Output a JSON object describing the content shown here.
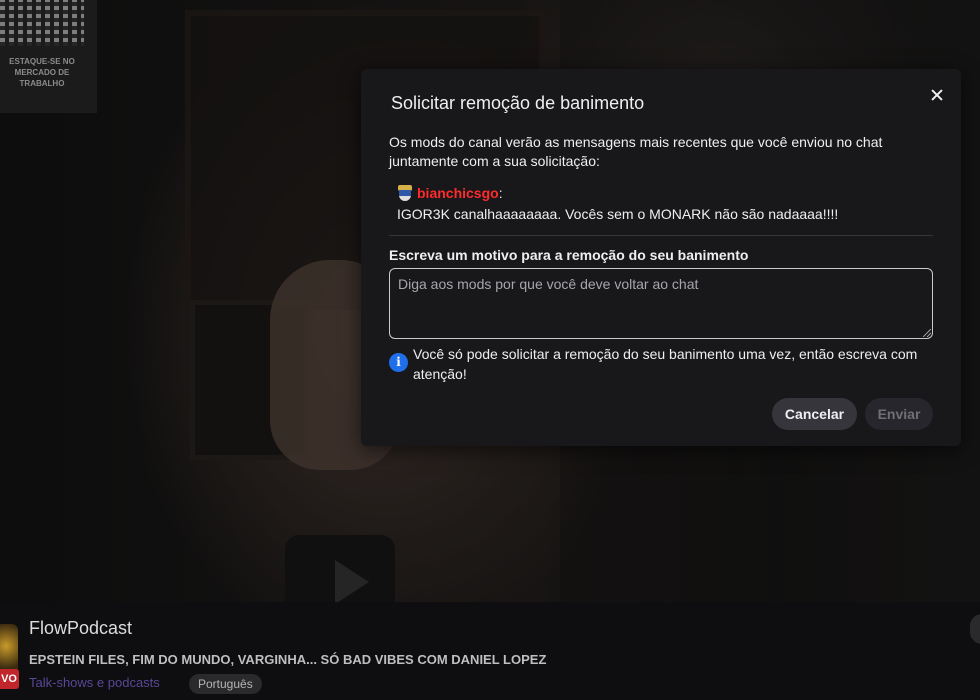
{
  "promo": {
    "text": "ESTAQUE-SE NO MERCADO DE TRABALHO"
  },
  "channel": {
    "name": "FlowPodcast",
    "stream_title": "EPSTEIN FILES, FIM DO MUNDO, VARGINHA... SÓ BAD VIBES COM DANIEL LOPEZ",
    "category": "Talk-shows e podcasts",
    "language": "Português",
    "live_label": "VO"
  },
  "modal": {
    "title": "Solicitar remoção de banimento",
    "description": "Os mods do canal verão as mensagens mais recentes que você enviou no chat juntamente com a sua solicitação:",
    "message": {
      "badge_icon": "2032-badge-icon",
      "username": "bianchicsgo",
      "colon": ":",
      "text": "IGOR3K canalhaaaaaaaa. Vocês sem o MONARK não são nadaaaa!!!!"
    },
    "reason_label": "Escreva um motivo para a remoção do seu banimento",
    "reason_placeholder": "Diga aos mods por que você deve voltar ao chat",
    "reason_value": "",
    "note": "Você só pode solicitar a remoção do seu banimento uma vez, então escreva com atenção!",
    "cancel_label": "Cancelar",
    "send_label": "Enviar",
    "colors": {
      "username": "#ff2a2a",
      "info_icon": "#1f6feb",
      "modal_bg": "#18181b"
    }
  }
}
